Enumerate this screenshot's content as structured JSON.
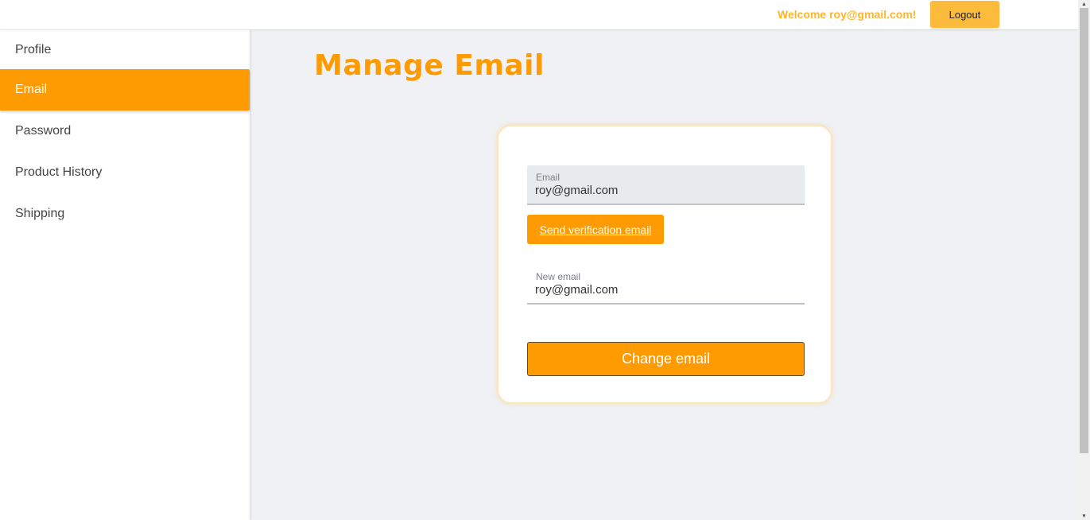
{
  "header": {
    "welcome": "Welcome roy@gmail.com!",
    "logout_label": "Logout"
  },
  "sidebar": {
    "items": [
      {
        "label": "Profile"
      },
      {
        "label": "Email",
        "active": true
      },
      {
        "label": "Password"
      },
      {
        "label": "Product History"
      },
      {
        "label": "Shipping"
      }
    ]
  },
  "main": {
    "title": "Manage Email",
    "email_field": {
      "label": "Email",
      "value": "roy@gmail.com"
    },
    "verify_label": "Send verification email",
    "new_email_field": {
      "label": "New email",
      "value": "roy@gmail.com"
    },
    "change_label": "Change email"
  },
  "colors": {
    "accent": "#fe9b03",
    "header_accent": "#fdb52b",
    "logout_bg": "#fdbb3b"
  },
  "icons": {
    "scroll_up": "triangle-up-icon",
    "scroll_down": "triangle-down-icon"
  }
}
